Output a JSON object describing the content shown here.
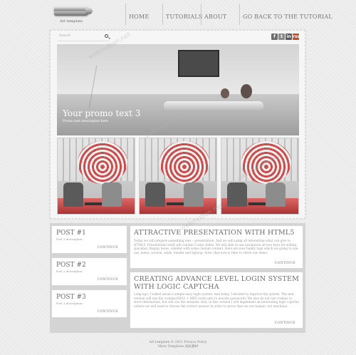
{
  "header": {
    "logo_text": "Art template",
    "nav": [
      {
        "label": "HOME"
      },
      {
        "label": "TUTORIALS"
      },
      {
        "label": "ABOUT"
      },
      {
        "label": "GO BACK TO THE TUTORIAL"
      }
    ]
  },
  "search": {
    "placeholder": "Search"
  },
  "social": [
    "f",
    "t",
    "in",
    "rss"
  ],
  "promo": {
    "title": "Your promo text 3",
    "subtitle": "Promo text description here"
  },
  "posts": [
    {
      "title": "POST #1",
      "description": "Post 1 description",
      "link": "CONTINUE"
    },
    {
      "title": "POST #2",
      "description": "Post 2 description",
      "link": "CONTINUE"
    },
    {
      "title": "POST #3",
      "description": "Post 3 description",
      "link": "CONTINUE"
    }
  ],
  "articles": [
    {
      "title": "ATTRACTIVE PRESENTATION WITH HTML5",
      "body": "Today we will prepare something new – presentation. And we will using all interesting what can give to HTML5. Presentation itself will contain 5 easy slides. We will able to use navigation arrows keys for sliding, spacebar, display notes, sidebar with some custom content. Here are new handy tags which we going to use: nav, menu, section, aside, header and hgroup. Sure, that now is time to check our demo.",
      "link": "CONTINUE"
    },
    {
      "title": "CREATING ADVANCE LEVEL LOGIN SYSTEM WITH LOGIC CAPTCHA",
      "body": "Long ago, I talked about a simple easy login system. And today, I decided to improve the system. The new version will use the cookies(SHA1 + MD5 (with salt) to encode password). We also do not use cookies to store information, but will use the sessions. And, in this version I will implement an interesting logic captcha (where we will need to choose the correct answer in order to prove that we are human, not machine).",
      "link": "CONTINUE"
    }
  ],
  "footer": {
    "line1": "Art template © 2011 Privacy Policy",
    "line2": "More Templates 站长素材"
  },
  "watermark": "webmoban.net"
}
